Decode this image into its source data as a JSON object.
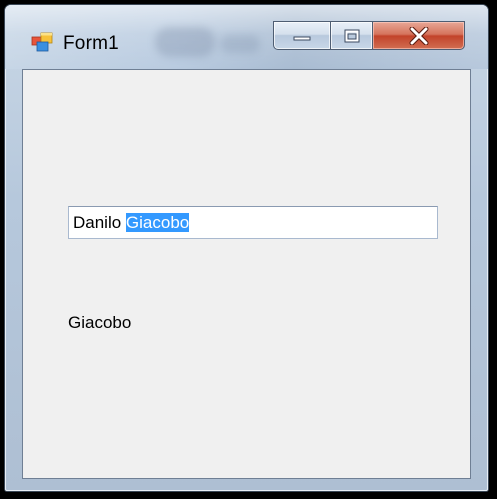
{
  "window": {
    "title": "Form1",
    "icon": "winforms-app-icon",
    "caption_buttons": {
      "minimize": "minimize-icon",
      "maximize": "maximize-icon",
      "close": "close-icon"
    }
  },
  "form": {
    "textbox": {
      "value_unselected": "Danilo ",
      "value_selected": "Giacobo"
    },
    "label": {
      "text": "Giacobo"
    }
  },
  "colors": {
    "selection": "#3399ff",
    "client_bg": "#f0f0f0",
    "close_button": "#c2432a"
  }
}
